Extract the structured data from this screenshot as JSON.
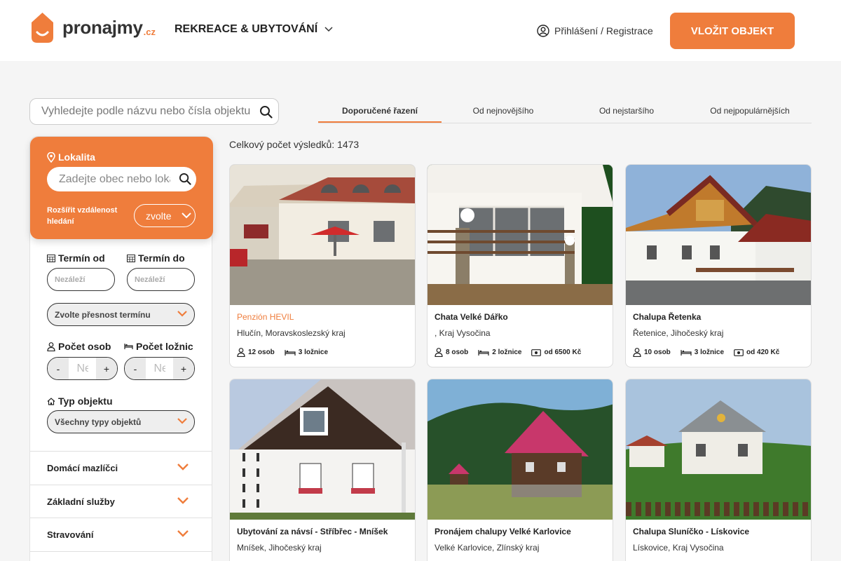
{
  "brand": {
    "name": "pronajmy",
    "tld": ".cz",
    "accent": "#ef7d3c"
  },
  "header": {
    "category_label": "REKREACE & UBYTOVÁNÍ",
    "login_label": "Přihlášení / Registrace",
    "add_button_label": "VLOŽIT OBJEKT"
  },
  "search": {
    "placeholder": "Vyhledejte podle názvu nebo čísla objektu"
  },
  "sort_tabs": [
    {
      "label": "Doporučené řazení",
      "active": true
    },
    {
      "label": "Od nejnovějšího",
      "active": false
    },
    {
      "label": "Od nejstaršího",
      "active": false
    },
    {
      "label": "Od nejpopulárnějších",
      "active": false
    }
  ],
  "filters": {
    "location": {
      "title": "Lokalita",
      "placeholder": "Zadejte obec nebo lokalitu",
      "radius_label": "Rozšířit vzdálenost hledání",
      "radius_value": "zvolte"
    },
    "date_from": {
      "label": "Termín od",
      "placeholder": "Nezáleží"
    },
    "date_to": {
      "label": "Termín do",
      "placeholder": "Nezáleží"
    },
    "date_precision": {
      "value": "Zvolte přesnost termínu"
    },
    "persons": {
      "label": "Počet osob",
      "placeholder": "Nezáleží",
      "minus": "-",
      "plus": "+"
    },
    "bedrooms": {
      "label": "Počet ložnic",
      "placeholder": "Nezáleží",
      "minus": "-",
      "plus": "+"
    },
    "property_type": {
      "label": "Typ objektu",
      "value": "Všechny typy objektů"
    },
    "accordions": [
      "Domácí mazlíčci",
      "Základní služby",
      "Stravování"
    ]
  },
  "results": {
    "count_text": "Celkový počet výsledků: 1473",
    "items": [
      {
        "name": "Penzión HEVIL",
        "place": "Hlučín, Moravskoslezský kraj",
        "persons": "12 osob",
        "bedrooms": "3 ložnice",
        "price": ""
      },
      {
        "name": "Chata Velké Dářko",
        "place": ", Kraj Vysočina",
        "persons": "8 osob",
        "bedrooms": "2 ložnice",
        "price": "od 6500 Kč"
      },
      {
        "name": "Chalupa Řetenka",
        "place": "Řetenice, Jihočeský kraj",
        "persons": "10 osob",
        "bedrooms": "3 ložnice",
        "price": "od 420 Kč"
      },
      {
        "name": "Ubytování za návsí - Stříbřec - Mníšek",
        "place": "Mníšek, Jihočeský kraj"
      },
      {
        "name": "Pronájem chalupy Velké Karlovice",
        "place": "Velké Karlovice, Zlínský kraj"
      },
      {
        "name": "Chalupa Sluníčko - Lískovice",
        "place": "Lískovice, Kraj Vysočina"
      }
    ]
  }
}
